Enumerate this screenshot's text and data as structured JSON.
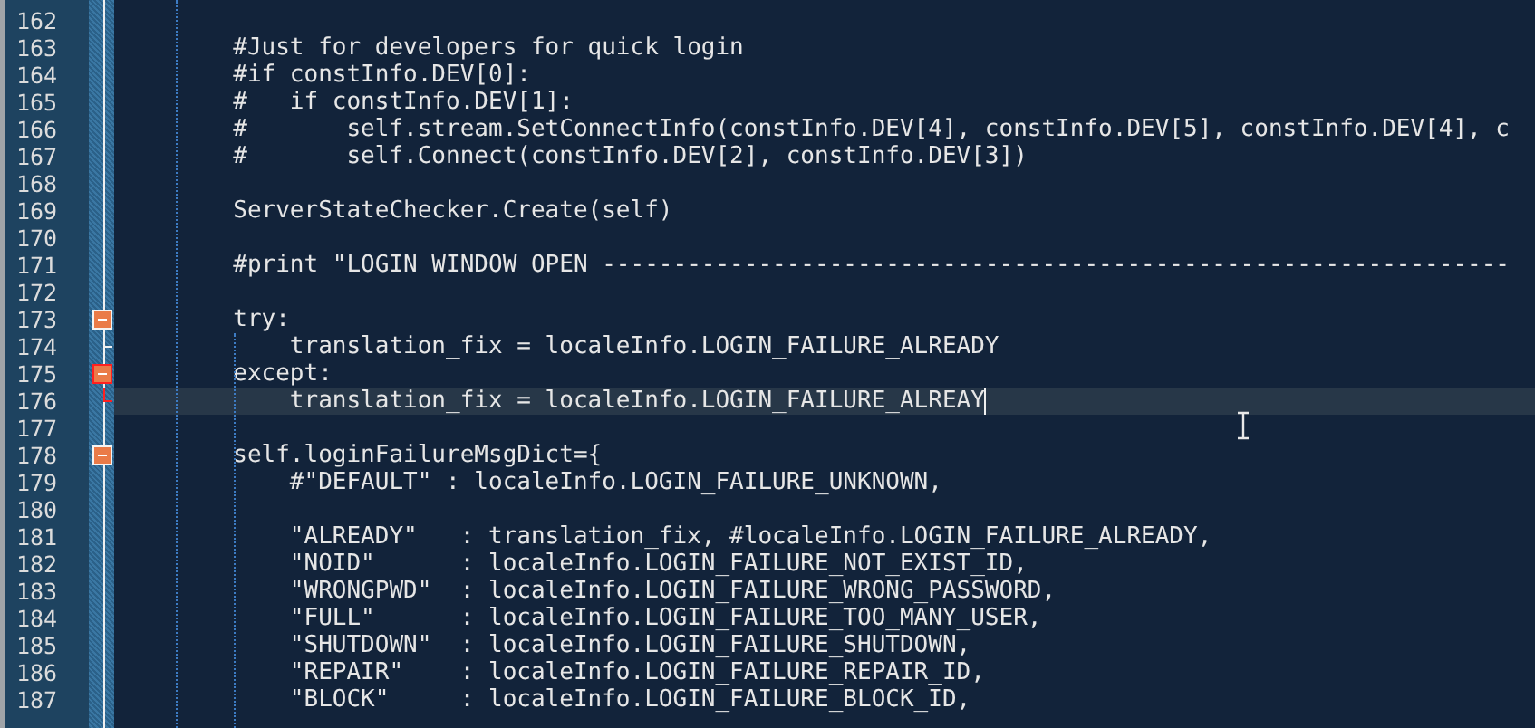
{
  "editor": {
    "lines": [
      {
        "number": "162",
        "current": false
      },
      {
        "number": "163",
        "text": "        #Just for developers for quick login",
        "current": false
      },
      {
        "number": "164",
        "text": "        #if constInfo.DEV[0]:",
        "current": false
      },
      {
        "number": "165",
        "text": "        #   if constInfo.DEV[1]:",
        "current": false
      },
      {
        "number": "166",
        "text": "        #       self.stream.SetConnectInfo(constInfo.DEV[4], constInfo.DEV[5], constInfo.DEV[4], c",
        "current": false
      },
      {
        "number": "167",
        "text": "        #       self.Connect(constInfo.DEV[2], constInfo.DEV[3])",
        "current": false
      },
      {
        "number": "168",
        "current": false
      },
      {
        "number": "169",
        "text": "        ServerStateChecker.Create(self)",
        "current": false
      },
      {
        "number": "170",
        "current": false
      },
      {
        "number": "171",
        "text": "        #print \"LOGIN WINDOW OPEN ----------------------------------------------------------------",
        "current": false
      },
      {
        "number": "172",
        "current": false
      },
      {
        "number": "173",
        "text": "        try:",
        "current": false,
        "fold": {
          "kind": "start",
          "highlighted": false
        }
      },
      {
        "number": "174",
        "text": "            translation_fix = localeInfo.LOGIN_FAILURE_ALREADY",
        "current": false,
        "fold": {
          "kind": "end",
          "highlighted": false
        }
      },
      {
        "number": "175",
        "text": "        except:",
        "current": false,
        "fold": {
          "kind": "start",
          "highlighted": true
        }
      },
      {
        "number": "176",
        "text": "            translation_fix = localeInfo.LOGIN_FAILURE_ALREAY",
        "current": true,
        "fold": {
          "kind": "end",
          "highlighted": true
        }
      },
      {
        "number": "177",
        "current": false
      },
      {
        "number": "178",
        "text": "        self.loginFailureMsgDict={",
        "current": false,
        "fold": {
          "kind": "start",
          "highlighted": false
        }
      },
      {
        "number": "179",
        "text": "            #\"DEFAULT\" : localeInfo.LOGIN_FAILURE_UNKNOWN,",
        "current": false
      },
      {
        "number": "180",
        "current": false
      },
      {
        "number": "181",
        "text": "            \"ALREADY\"   : translation_fix, #localeInfo.LOGIN_FAILURE_ALREADY,",
        "current": false
      },
      {
        "number": "182",
        "text": "            \"NOID\"      : localeInfo.LOGIN_FAILURE_NOT_EXIST_ID,",
        "current": false
      },
      {
        "number": "183",
        "text": "            \"WRONGPWD\"  : localeInfo.LOGIN_FAILURE_WRONG_PASSWORD,",
        "current": false
      },
      {
        "number": "184",
        "text": "            \"FULL\"      : localeInfo.LOGIN_FAILURE_TOO_MANY_USER,",
        "current": false
      },
      {
        "number": "185",
        "text": "            \"SHUTDOWN\"  : localeInfo.LOGIN_FAILURE_SHUTDOWN,",
        "current": false
      },
      {
        "number": "186",
        "text": "            \"REPAIR\"    : localeInfo.LOGIN_FAILURE_REPAIR_ID,",
        "current": false
      },
      {
        "number": "187",
        "text": "            \"BLOCK\"     : localeInfo.LOGIN_FAILURE_BLOCK_ID,",
        "current": false
      }
    ]
  }
}
